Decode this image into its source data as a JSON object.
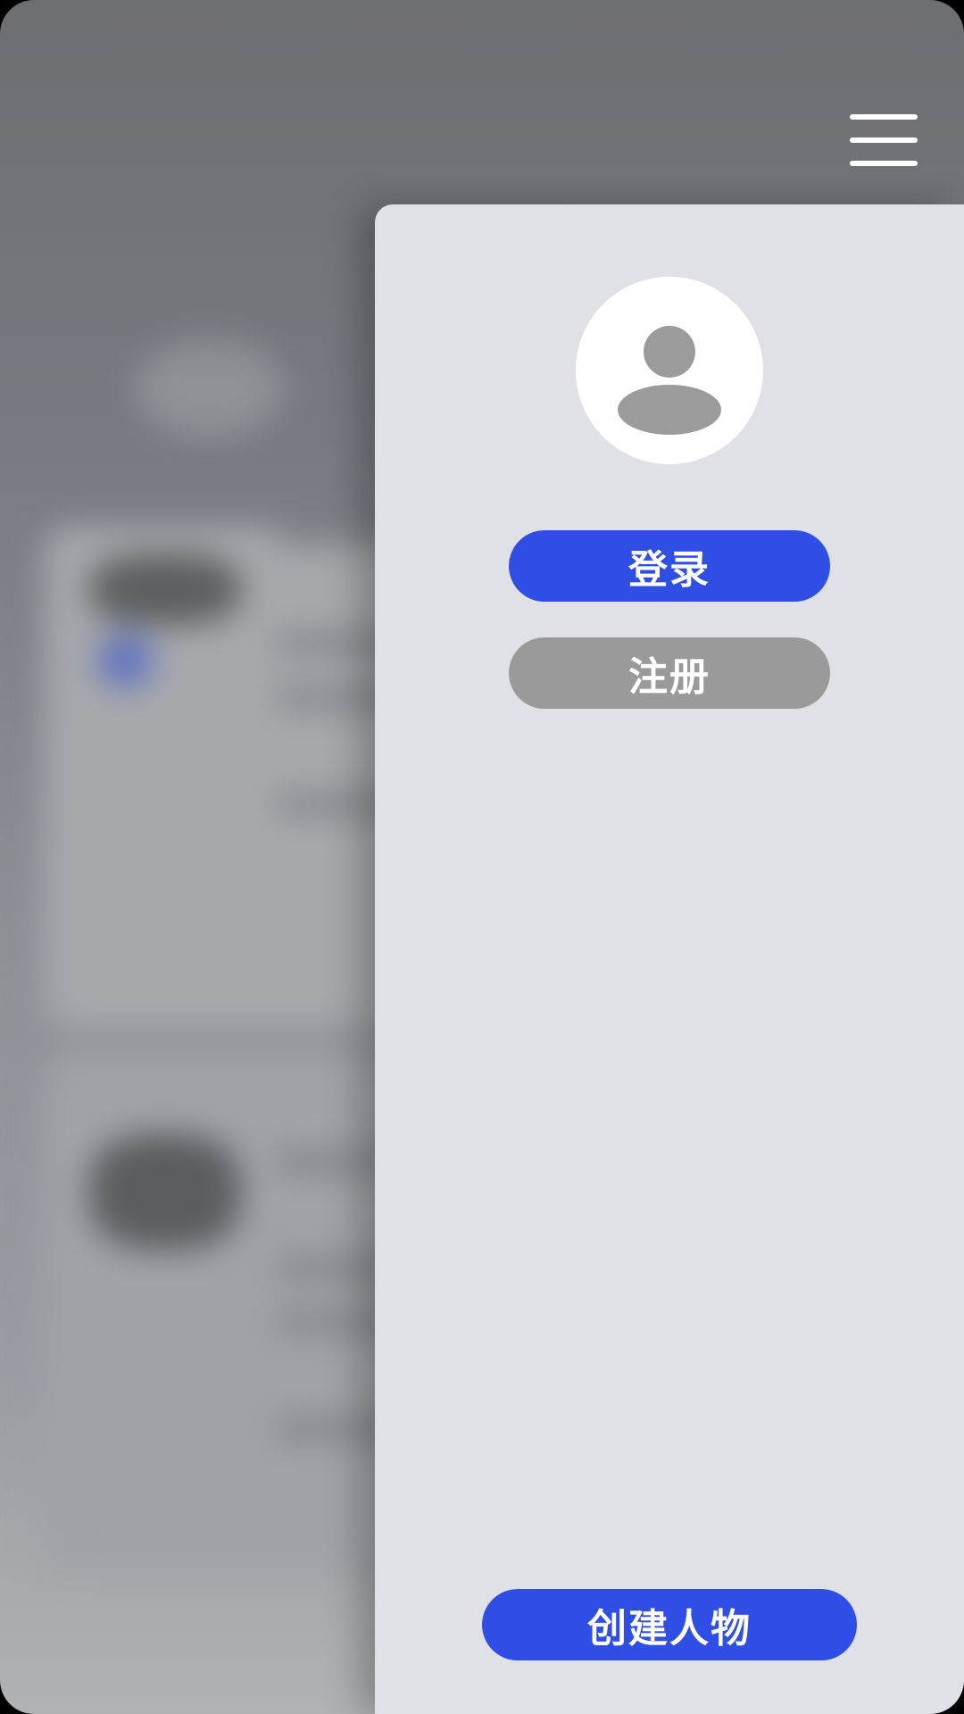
{
  "drawer": {
    "login_label": "登录",
    "register_label": "注册",
    "create_character_label": "创建人物"
  },
  "colors": {
    "primary": "#2f4ee6",
    "secondary": "#9a9a9a",
    "drawer_background": "#e0e1e6"
  },
  "icons": {
    "menu": "hamburger-menu-icon",
    "avatar": "user-avatar-icon"
  }
}
